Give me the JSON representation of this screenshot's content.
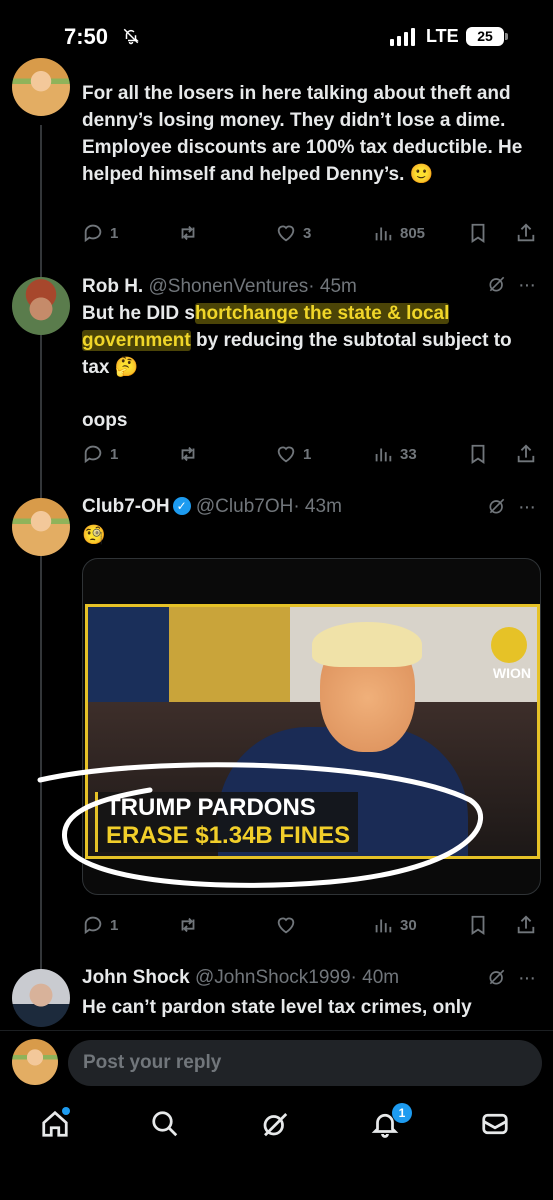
{
  "status_bar": {
    "time": "7:50",
    "network": "LTE",
    "battery": "25"
  },
  "tweets": [
    {
      "text": "For all the losers in here talking about theft and denny’s losing money. They didn’t lose a dime. Employee discounts are 100% tax deductible. He helped himself and helped Denny’s. 🙂",
      "replies": "1",
      "reposts": "",
      "likes": "3",
      "views": "805"
    },
    {
      "name": "Rob H.",
      "handle": "@ShonenVentures",
      "time": "· 45m",
      "text_pre": "But he DID s",
      "text_highlight_1": "hortchange the state & local",
      "text_highlight_2": "government",
      "text_post": " by reducing the subtotal subject to tax 🤔",
      "text_second": "oops",
      "replies": "1",
      "reposts": "",
      "likes": "1",
      "views": "33"
    },
    {
      "name": "Club7-OH",
      "handle": "@Club7OH",
      "time": "· 43m",
      "text": "🧐",
      "media_caption_1": "TRUMP PARDONS",
      "media_caption_2": "ERASE $1.34B FINES",
      "media_brand": "WION",
      "replies": "1",
      "reposts": "",
      "likes": "",
      "views": "30"
    },
    {
      "name": "John Shock",
      "handle": "@JohnShock1999",
      "time": "· 40m",
      "text": "He can’t pardon state level tax crimes, only"
    }
  ],
  "reply_bar": {
    "placeholder": "Post your reply"
  },
  "nav": {
    "notifications_count": "1"
  },
  "icons": [
    "bell-slash-icon",
    "reply-icon",
    "repost-icon",
    "like-icon",
    "views-icon",
    "bookmark-icon",
    "share-icon",
    "grok-icon",
    "more-icon",
    "home-icon",
    "search-icon",
    "notifications-icon",
    "messages-icon"
  ]
}
